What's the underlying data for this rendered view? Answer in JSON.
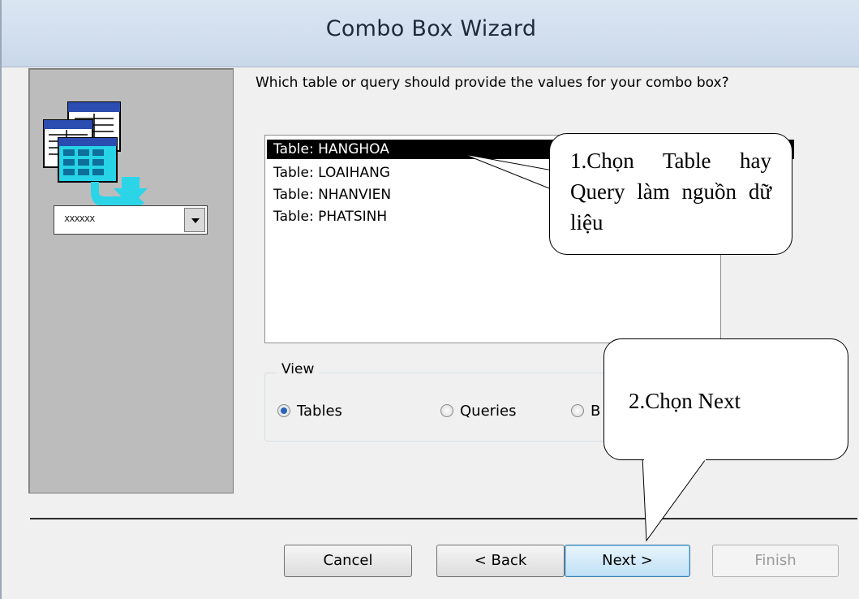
{
  "window": {
    "title": "Combo Box Wizard"
  },
  "illustration": {
    "combo_placeholder": "xxxxxx"
  },
  "question": "Which table or query should provide the values for your combo box?",
  "list": {
    "items": [
      "Table: HANGHOA",
      "Table: LOAIHANG",
      "Table: NHANVIEN",
      "Table: PHATSINH"
    ],
    "selected_index": 0
  },
  "view_group": {
    "label": "View",
    "options": [
      {
        "label": "Tables",
        "checked": true
      },
      {
        "label": "Queries",
        "checked": false
      },
      {
        "label": "B",
        "checked": false
      }
    ]
  },
  "buttons": {
    "cancel": "Cancel",
    "back": "< Back",
    "next": "Next >",
    "finish": "Finish"
  },
  "annotations": {
    "callout1": "1.Chọn Table hay Query làm nguồn dữ liệu",
    "callout2": "2.Chọn Next"
  },
  "colors": {
    "titlebar": "#c9d8ea",
    "selection": "#000000",
    "accent_button": "#bfe0f5"
  }
}
